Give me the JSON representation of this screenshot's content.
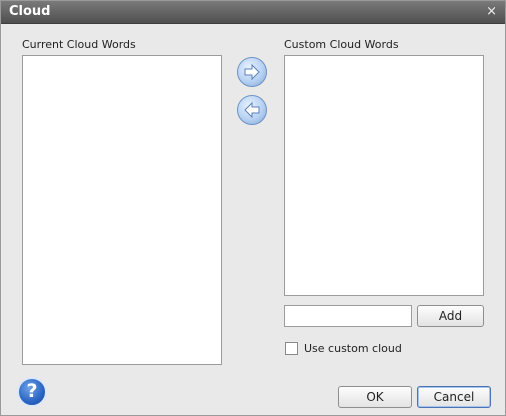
{
  "window": {
    "title": "Cloud",
    "close_glyph": "×"
  },
  "lists": {
    "current_label": "Current Cloud Words",
    "custom_label": "Custom Cloud Words",
    "current_items": [],
    "custom_items": []
  },
  "controls": {
    "word_input_value": "",
    "add_label": "Add",
    "use_custom_label": "Use custom cloud",
    "use_custom_checked": false,
    "help_glyph": "?",
    "ok_label": "OK",
    "cancel_label": "Cancel"
  },
  "icons": {
    "move_right": "arrow-right-icon",
    "move_left": "arrow-left-icon",
    "help": "help-icon"
  },
  "colors": {
    "title_bar": "#5a5a5a",
    "dialog_bg": "#e9e9e9",
    "arrow_button": "#b7d1f2",
    "help": "#2a64c3"
  }
}
